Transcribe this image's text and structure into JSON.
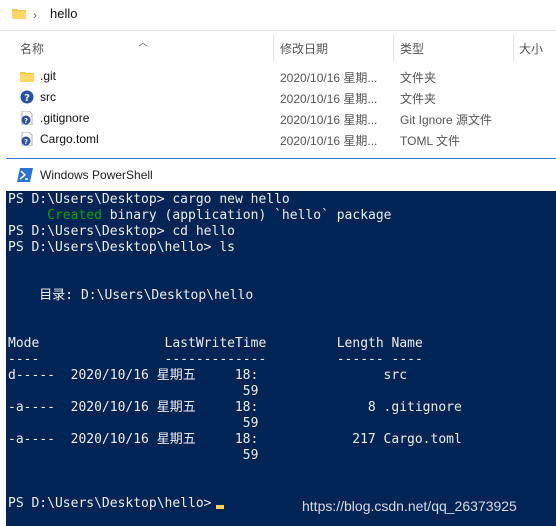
{
  "explorer": {
    "breadcrumb": {
      "separator": "›",
      "path": "hello"
    },
    "columns": {
      "name": "名称",
      "date": "修改日期",
      "type": "类型",
      "size": "大小"
    },
    "files": [
      {
        "name": ".git",
        "date": "2020/10/16 星期...",
        "type": "文件夹",
        "icon": "folder-icon"
      },
      {
        "name": "src",
        "date": "2020/10/16 星期...",
        "type": "文件夹",
        "icon": "unknown-file-icon"
      },
      {
        "name": ".gitignore",
        "date": "2020/10/16 星期...",
        "type": "Git Ignore 源文件",
        "icon": "unknown-file-icon"
      },
      {
        "name": "Cargo.toml",
        "date": "2020/10/16 星期...",
        "type": "TOML 文件",
        "icon": "unknown-file-icon"
      }
    ]
  },
  "powershell": {
    "title": "Windows PowerShell",
    "colors": {
      "background": "#012456",
      "text": "#eeedf0",
      "green": "#13a10e",
      "cursor": "#ffd54f"
    },
    "lines": {
      "l1": "PS D:\\Users\\Desktop> cargo new hello",
      "l2_created": "     Created",
      "l2_rest": " binary (application) `hello` package",
      "l3": "PS D:\\Users\\Desktop> cd hello",
      "l4": "PS D:\\Users\\Desktop\\hello> ls",
      "dir": "    目录: D:\\Users\\Desktop\\hello",
      "header": "Mode                LastWriteTime         Length Name",
      "underline": "----                -------------         ------ ----",
      "r1": "d-----  2020/10/16 星期五     18:                src",
      "r1b": "                              59",
      "r2": "-a----  2020/10/16 星期五     18:              8 .gitignore",
      "r2b": "                              59",
      "r3": "-a----  2020/10/16 星期五     18:            217 Cargo.toml",
      "r3b": "                              59",
      "prompt": "PS D:\\Users\\Desktop\\hello>"
    }
  },
  "watermark": "https://blog.csdn.net/qq_26373925"
}
